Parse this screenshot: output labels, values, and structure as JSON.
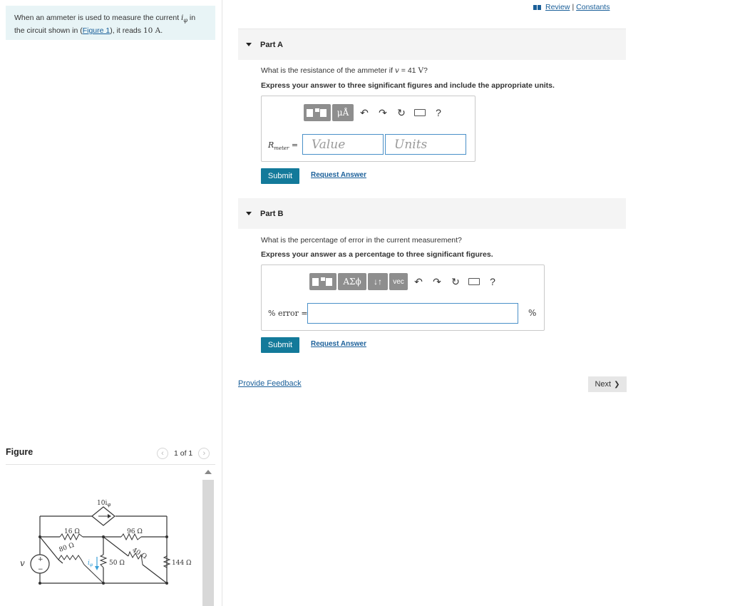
{
  "problem": {
    "text_before": "When an ammeter is used to measure the current ",
    "symbol": "i",
    "symbol_sub": "φ",
    "text_middle": " in the circuit shown in (",
    "figure_link": "Figure 1",
    "text_after": "), it reads ",
    "reading": "10 A",
    "text_end": "."
  },
  "top_links": {
    "review": "Review",
    "separator": "|",
    "constants": "Constants"
  },
  "part_a": {
    "title": "Part A",
    "question_before": "What is the resistance of the ammeter if ",
    "question_var": "v",
    "question_mid": " = 41 ",
    "question_unit": "V",
    "question_end": "?",
    "instruction": "Express your answer to three significant figures and include the appropriate units.",
    "toolbar": {
      "templates_icon": "templates-icon",
      "units_label": "μÅ",
      "undo": "↶",
      "redo": "↷",
      "reset": "↻",
      "help": "?"
    },
    "variable": "R",
    "variable_sub": "meter",
    "equals": "=",
    "value_placeholder": "Value",
    "units_placeholder": "Units",
    "submit": "Submit",
    "request": "Request Answer"
  },
  "part_b": {
    "title": "Part B",
    "question": "What is the percentage of error in the current measurement?",
    "instruction": "Express your answer as a percentage to three significant figures.",
    "toolbar": {
      "greek_label": "ΑΣϕ",
      "arrows_label": "↓↑",
      "vec_label": "vec",
      "undo": "↶",
      "redo": "↷",
      "reset": "↻",
      "help": "?"
    },
    "variable": "% error",
    "equals": "=",
    "unit": "%",
    "submit": "Submit",
    "request": "Request Answer"
  },
  "feedback_link": "Provide Feedback",
  "next": "Next",
  "next_icon": "❯",
  "figure": {
    "title": "Figure",
    "pager": "1 of 1",
    "prev_icon": "‹",
    "next_icon": "›",
    "circuit": {
      "dep_source_label": "10i",
      "dep_source_sub": "φ",
      "r1": "16 Ω",
      "r2": "96 Ω",
      "r3": "80 Ω",
      "r4": "40 Ω",
      "r5": "50 Ω",
      "r6": "144 Ω",
      "source_label": "v",
      "plus": "+",
      "minus": "−",
      "current_label": "i",
      "current_sub": "φ"
    }
  },
  "colors": {
    "problem_bg": "#e8f4f6",
    "submit_bg": "#137a9a",
    "link": "#1a5f99",
    "input_border": "#4a90c8",
    "current_arrow": "#3aa0d8"
  }
}
